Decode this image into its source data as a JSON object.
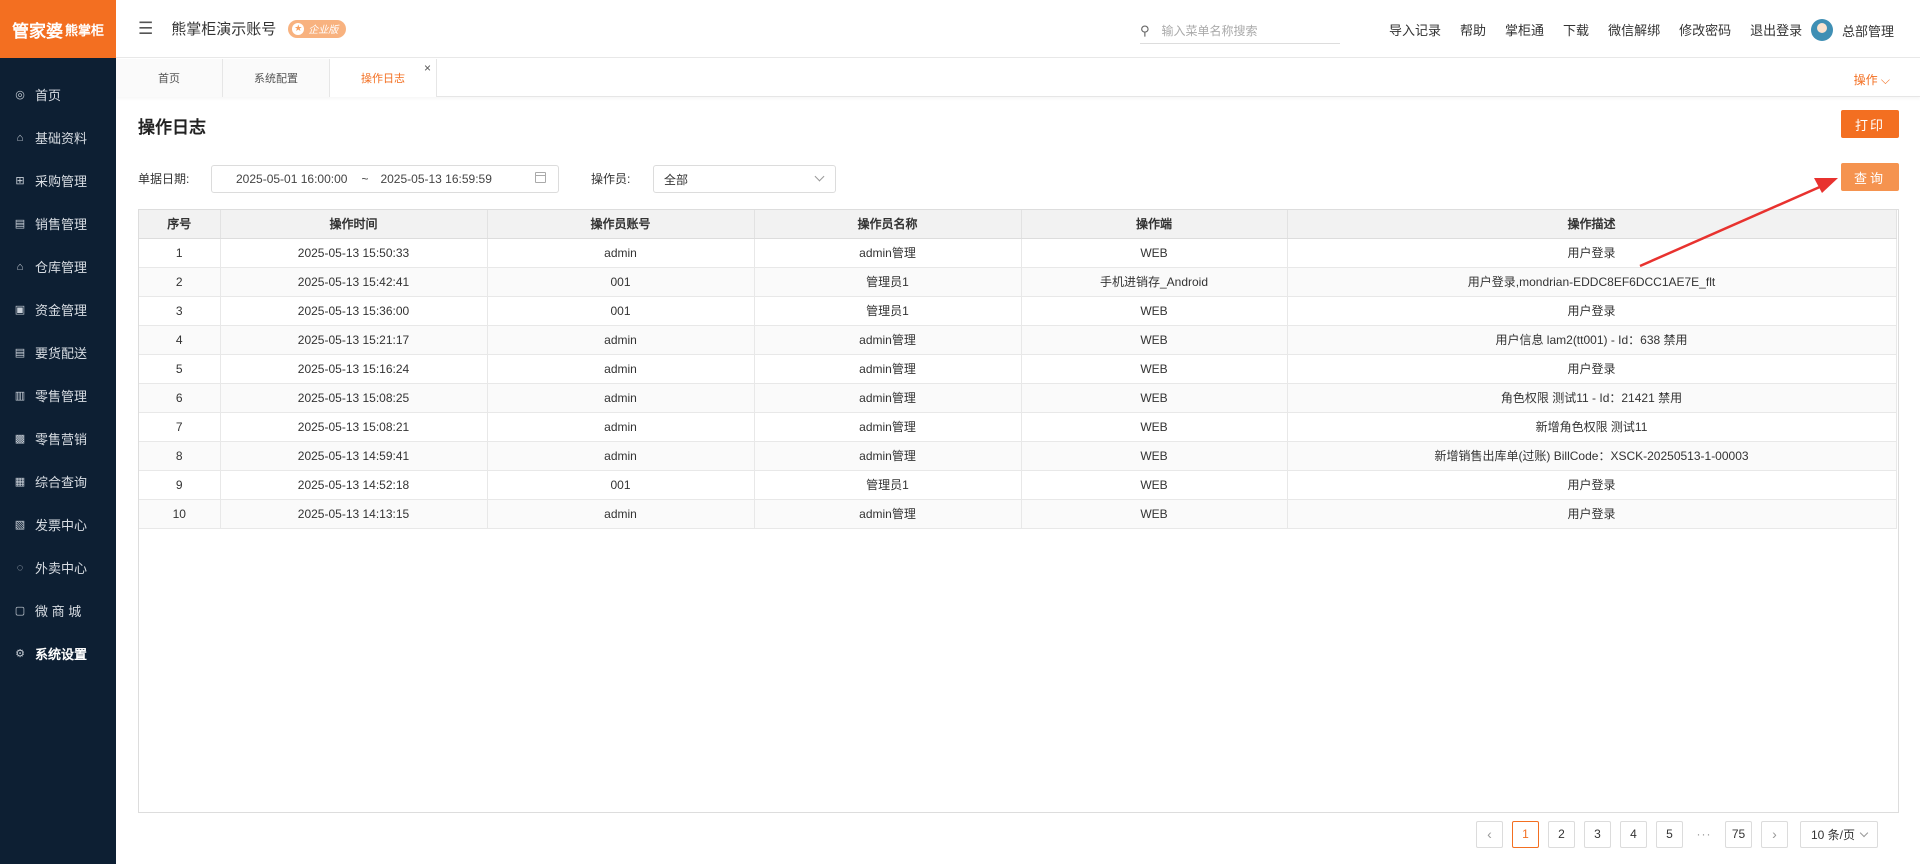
{
  "sidebar": {
    "logo_main": "管家婆",
    "logo_sub": "熊掌柜",
    "items": [
      {
        "label": "首页",
        "icon": "globe-icon",
        "glyph": "◎"
      },
      {
        "label": "基础资料",
        "icon": "home-icon",
        "glyph": "⌂"
      },
      {
        "label": "采购管理",
        "icon": "cart-icon",
        "glyph": "⊞"
      },
      {
        "label": "销售管理",
        "icon": "sales-icon",
        "glyph": "▤"
      },
      {
        "label": "仓库管理",
        "icon": "warehouse-icon",
        "glyph": "⌂"
      },
      {
        "label": "资金管理",
        "icon": "wallet-icon",
        "glyph": "▣"
      },
      {
        "label": "要货配送",
        "icon": "delivery-icon",
        "glyph": "▤"
      },
      {
        "label": "零售管理",
        "icon": "chart-bar-icon",
        "glyph": "▥"
      },
      {
        "label": "零售营销",
        "icon": "gift-icon",
        "glyph": "▩"
      },
      {
        "label": "综合查询",
        "icon": "chart-line-icon",
        "glyph": "▦"
      },
      {
        "label": "发票中心",
        "icon": "invoice-icon",
        "glyph": "▧"
      },
      {
        "label": "外卖中心",
        "icon": "alarm-icon",
        "glyph": "◌"
      },
      {
        "label": "微 商 城",
        "icon": "shop-icon",
        "glyph": "▢"
      },
      {
        "label": "系统设置",
        "icon": "gear-icon",
        "glyph": "⚙"
      }
    ]
  },
  "header": {
    "app_title": "熊掌柜演示账号",
    "edition_badge": "企业版",
    "search_placeholder": "输入菜单名称搜索",
    "links": [
      "导入记录",
      "帮助",
      "掌柜通",
      "下载",
      "微信解绑",
      "修改密码",
      "退出登录"
    ],
    "user_name": "总部管理"
  },
  "tabs": {
    "items": [
      "首页",
      "系统配置",
      "操作日志"
    ],
    "active": "操作日志",
    "ops_label": "操作 ⌵"
  },
  "page": {
    "title": "操作日志",
    "print_label": "打印",
    "query_label": "查询"
  },
  "filters": {
    "date_label": "单据日期:",
    "date_start": "2025-05-01 16:00:00",
    "date_sep": "~",
    "date_end": "2025-05-13 16:59:59",
    "operator_label": "操作员:",
    "operator_value": "全部"
  },
  "table": {
    "columns": [
      "序号",
      "操作时间",
      "操作员账号",
      "操作员名称",
      "操作端",
      "操作描述"
    ],
    "rows": [
      [
        "1",
        "2025-05-13 15:50:33",
        "admin",
        "admin管理",
        "WEB",
        "用户登录"
      ],
      [
        "2",
        "2025-05-13 15:42:41",
        "001",
        "管理员1",
        "手机进销存_Android",
        "用户登录,mondrian-EDDC8EF6DCC1AE7E_flt"
      ],
      [
        "3",
        "2025-05-13 15:36:00",
        "001",
        "管理员1",
        "WEB",
        "用户登录"
      ],
      [
        "4",
        "2025-05-13 15:21:17",
        "admin",
        "admin管理",
        "WEB",
        "用户信息 lam2(tt001) - Id：638 禁用"
      ],
      [
        "5",
        "2025-05-13 15:16:24",
        "admin",
        "admin管理",
        "WEB",
        "用户登录"
      ],
      [
        "6",
        "2025-05-13 15:08:25",
        "admin",
        "admin管理",
        "WEB",
        "角色权限 测试11 - Id：21421 禁用"
      ],
      [
        "7",
        "2025-05-13 15:08:21",
        "admin",
        "admin管理",
        "WEB",
        "新增角色权限 测试11"
      ],
      [
        "8",
        "2025-05-13 14:59:41",
        "admin",
        "admin管理",
        "WEB",
        "新增销售出库单(过账) BillCode：XSCK-20250513-1-00003"
      ],
      [
        "9",
        "2025-05-13 14:52:18",
        "001",
        "管理员1",
        "WEB",
        "用户登录"
      ],
      [
        "10",
        "2025-05-13 14:13:15",
        "admin",
        "admin管理",
        "WEB",
        "用户登录"
      ]
    ]
  },
  "pagination": {
    "prev": "‹",
    "pages": [
      "1",
      "2",
      "3",
      "4",
      "5"
    ],
    "current": "1",
    "ellipsis": "···",
    "last_page": "75",
    "next": "›",
    "page_size": "10 条/页"
  },
  "colors": {
    "accent": "#f36f21",
    "sidebar_bg": "#0d1f33",
    "annotation_arrow": "#e8322f"
  }
}
